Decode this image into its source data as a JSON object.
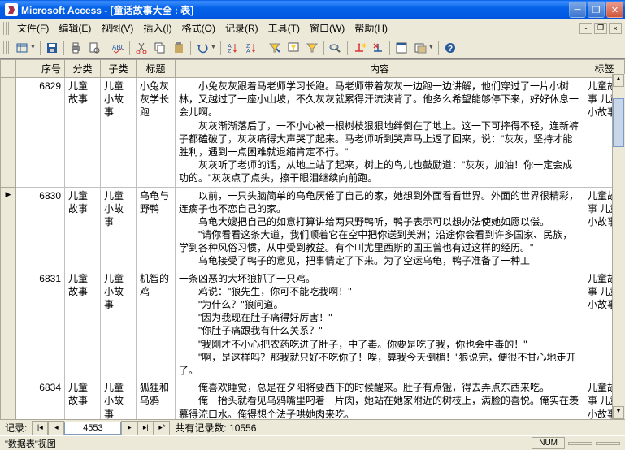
{
  "window": {
    "title": "Microsoft Access - [童话故事大全 : 表]"
  },
  "menu": {
    "items": [
      "文件(F)",
      "编辑(E)",
      "视图(V)",
      "插入(I)",
      "格式(O)",
      "记录(R)",
      "工具(T)",
      "窗口(W)",
      "帮助(H)"
    ]
  },
  "grid": {
    "headers": [
      "序号",
      "分类",
      "子类",
      "标题",
      "内容",
      "标签"
    ],
    "rows": [
      {
        "selector": "",
        "seq": "6829",
        "cat": "儿童故事",
        "sub": "儿童小故事",
        "title": "小兔灰灰学长跑",
        "content": "　　小兔灰灰跟着马老师学习长跑。马老师带着灰灰一边跑一边讲解，他们穿过了一片小树林，又越过了一座小山坡，不久灰灰就累得汗流浃背了。他多么希望能够停下来，好好休息一会儿啊。\n　　灰灰渐渐落后了，一不小心被一根树枝狠狠地绊倒在了地上。这一下可摔得不轻，连新裤子都磕破了，灰灰痛得大声哭了起来。马老师听到哭声马上返了回来，说：\"灰灰，坚持才能胜利，遇到一点困难就退缩肯定不行。\"\n　　灰灰听了老师的话，从地上站了起来，树上的鸟儿也鼓励道：\"灰灰，加油！你一定会成功的。\"灰灰点了点头，擦干眼泪继续向前跑。",
        "tag": "儿童故事 儿童小故事"
      },
      {
        "selector": "▶",
        "seq": "6830",
        "cat": "儿童故事",
        "sub": "儿童小故事",
        "title": "乌龟与野鸭",
        "content": "　　以前，一只头脑简单的乌龟厌倦了自己的家，她想到外面看看世界。外面的世界很精彩，连瘸子也不恋自己的家。\n　　乌龟大嫂把自己的如意打算讲给两只野鸭听，鸭子表示可以想办法使她如愿以偿。\n　　\"请你看看这条大道，我们顺着它在空中把你送到美洲；沿途你会看到许多国家、民族，学到各种风俗习惯，从中受到教益。有个叫尤里西斯的国王曾也有过这样的经历。\"\n　　乌龟接受了鸭子的意见，把事情定了下来。为了空运乌龟，鸭子准备了一种工",
        "tag": "儿童故事 儿童小故事"
      },
      {
        "selector": "",
        "seq": "6831",
        "cat": "儿童故事",
        "sub": "儿童小故事",
        "title": "机智的鸡",
        "content": "一条凶恶的大坏狼抓了一只鸡。\n　　鸡说：\"狼先生，你可不能吃我啊！\"\n　　\"为什么？\"狼问道。\n　　\"因为我现在肚子痛得好厉害！\"\n　　\"你肚子痛跟我有什么关系？\"\n　　\"我刚才不小心把农药吃进了肚子，中了毒。你要是吃了我，你也会中毒的！\"\n　　\"啊，是这样吗？那我就只好不吃你了！唉，算我今天倒楣！\"狼说完，便很不甘心地走开了。",
        "tag": "儿童故事 儿童小故事"
      },
      {
        "selector": "",
        "seq": "6834",
        "cat": "儿童故事",
        "sub": "儿童小故事",
        "title": "狐狸和乌鸦",
        "content": "　　俺喜欢睡觉，总是在夕阳将要西下的时候醒来。肚子有点饿，得去弄点东西来吃。\n　　俺一抬头就看见乌鸦嘴里叼着一片肉，她站在她家附近的树枝上，满脸的喜悦。俺实在羡慕得流口水。俺得想个法子哄她肉来吃。\n　　像她这样丑陋又弱智的东西，以前可太好得理她。俺这回却是满脸谄笑地同她打招呼：\"您好，亲爱的乌鸦！\"她似乎没有听见。",
        "tag": "儿童故事 儿童小故事"
      }
    ]
  },
  "nav": {
    "label": "记录:",
    "current": "4553",
    "total_label": "共有记录数:",
    "total": "10556"
  },
  "status": {
    "view": "\"数据表\"视图",
    "num": "NUM"
  }
}
